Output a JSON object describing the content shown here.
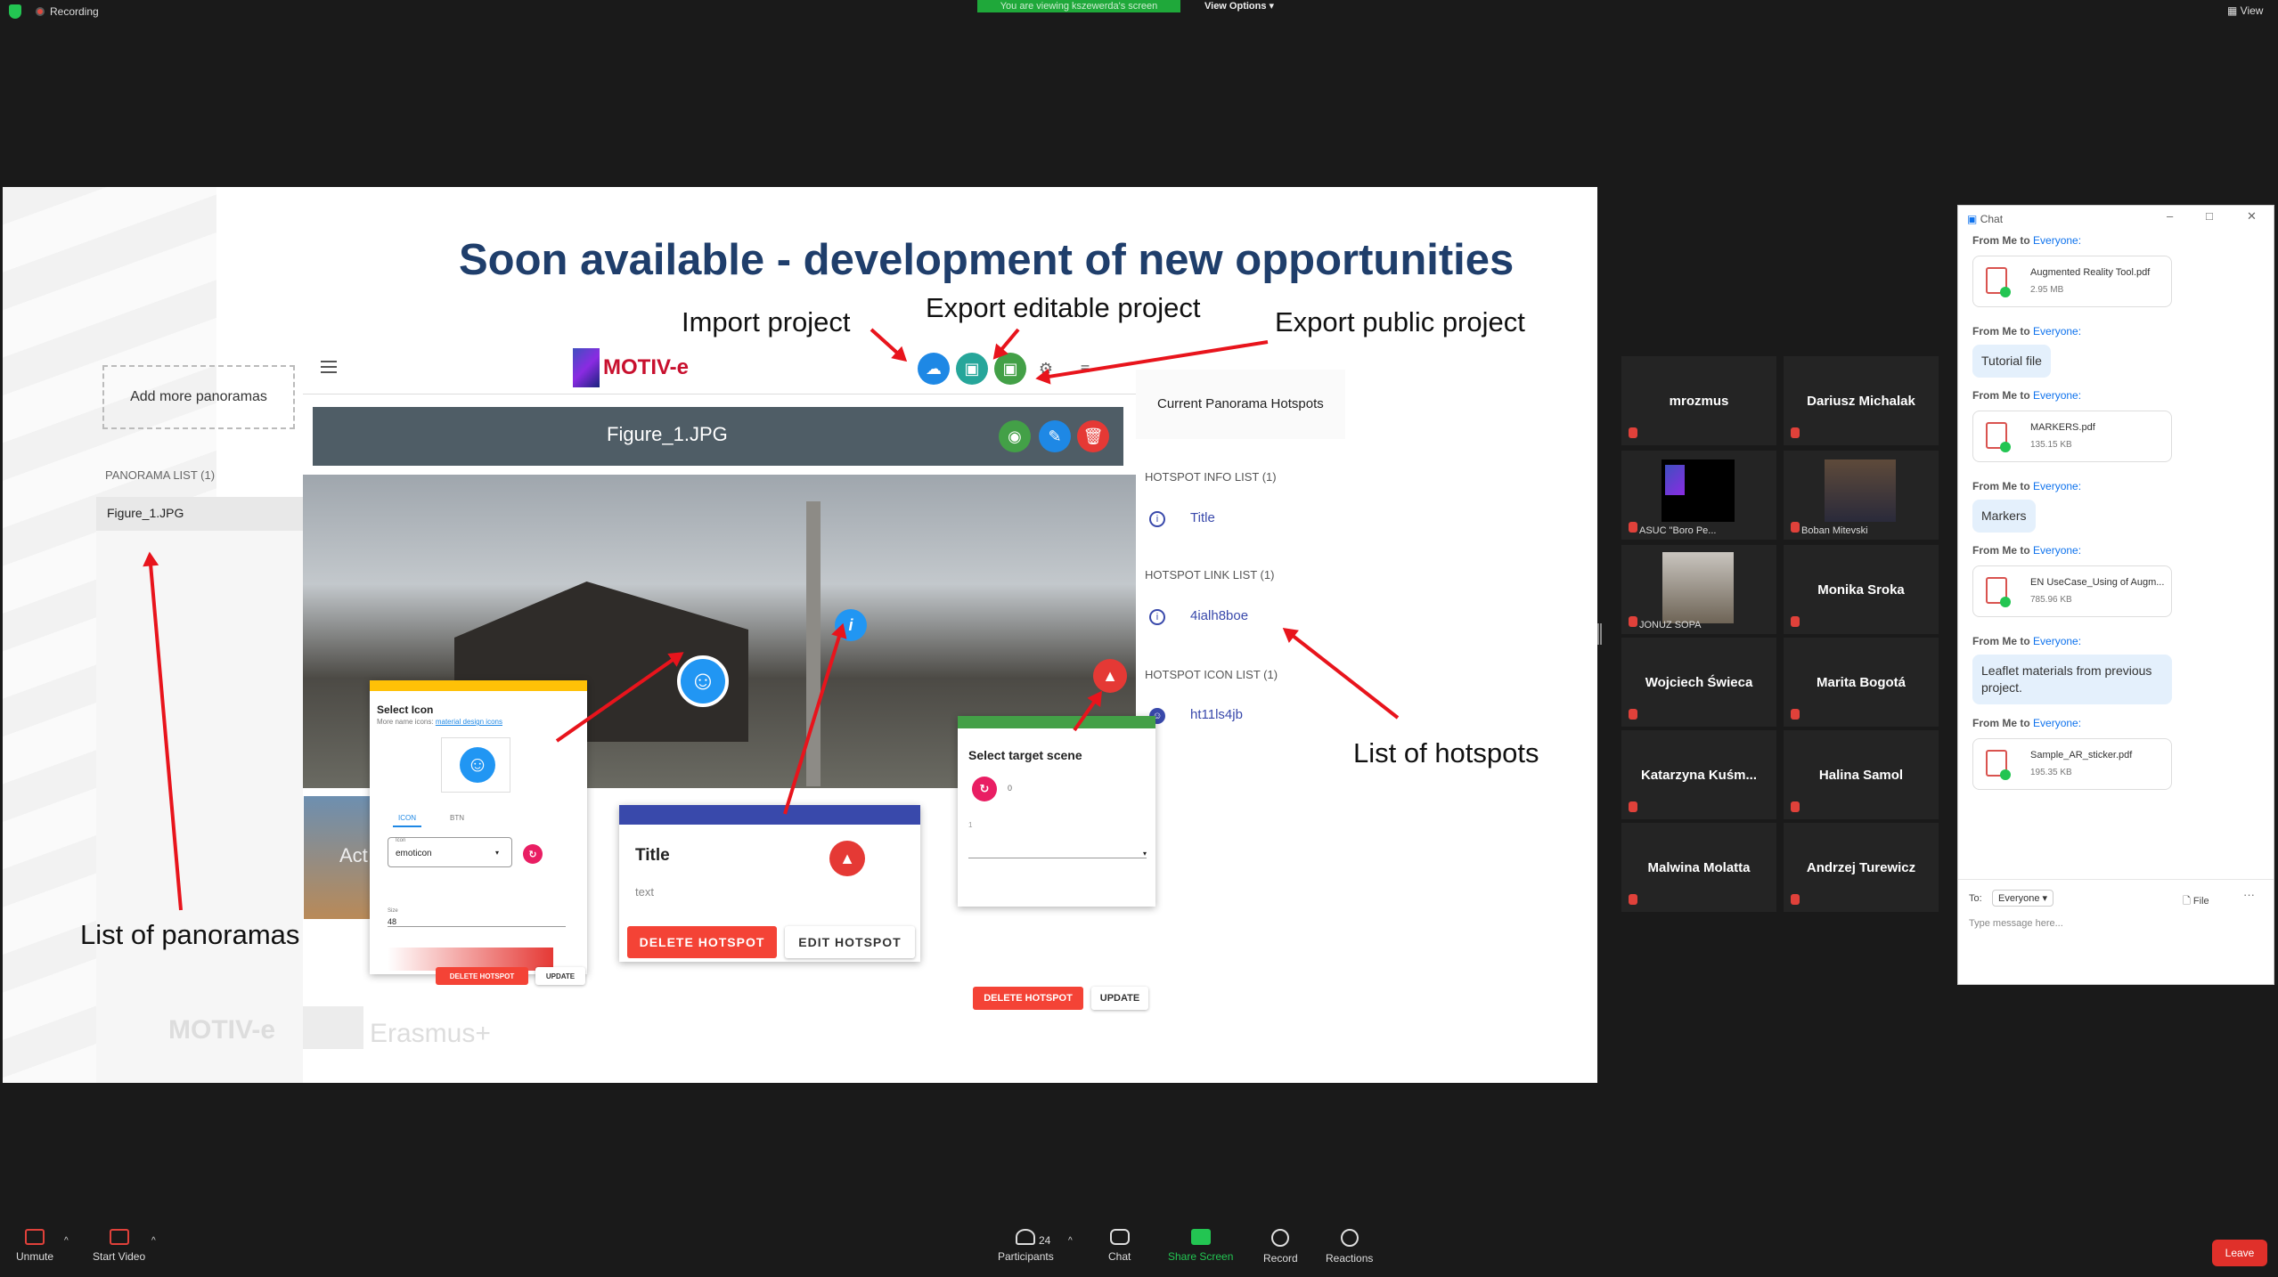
{
  "topbar": {
    "recording": "Recording",
    "viewing_banner": "You are viewing kszewerda's screen",
    "view_options": "View Options",
    "view": "View"
  },
  "slide": {
    "title": "Soon available - development of new opportunities",
    "callouts": {
      "import": "Import project",
      "export_editable": "Export editable project",
      "export_public": "Export public project",
      "list_hotspots": "List of hotspots",
      "list_panoramas": "List of panoramas"
    },
    "app": {
      "add_more": "Add more panoramas",
      "panorama_list_title": "PANORAMA LIST (1)",
      "panorama_item": "Figure_1.JPG",
      "logo_text": "MOTIV-e",
      "figure_name": "Figure_1.JPG",
      "current_hotspots": "Current Panorama Hotspots",
      "info_list_title": "HOTSPOT INFO LIST (1)",
      "info_item": "Title",
      "link_list_title": "HOTSPOT LINK LIST (1)",
      "link_item": "4ialh8boe",
      "icon_list_title": "HOTSPOT ICON LIST (1)",
      "icon_item": "ht11ls4jb"
    },
    "select_icon_dialog": {
      "title": "Select Icon",
      "more": "More name icons:",
      "link": "material design icons",
      "tab_icon": "ICON",
      "tab_btn": "BTN",
      "field_label": "Icon",
      "field_value": "emoticon",
      "size_label": "Size",
      "size_value": "48",
      "delete": "DELETE HOTSPOT",
      "update": "UPDATE"
    },
    "info_card": {
      "title": "Title",
      "text": "text",
      "delete": "DELETE HOTSPOT",
      "edit": "EDIT HOTSPOT"
    },
    "target_dialog": {
      "title": "Select target scene",
      "value_0": "0",
      "value_1": "1",
      "delete": "DELETE HOTSPOT",
      "update": "UPDATE"
    },
    "watermarks": {
      "motive": "MOTIV-e",
      "erasmus": "Erasmus+"
    },
    "logo_caption": "ASUC \"Boro Pe...",
    "preview_text": "Act"
  },
  "participants": [
    {
      "name": "mrozmus"
    },
    {
      "name": "Dariusz Michalak"
    },
    {
      "name": "ASUC \"Boro Pe..."
    },
    {
      "name": "Boban Mitevski"
    },
    {
      "name": "JONUZ SOPA"
    },
    {
      "name": "Monika Sroka"
    },
    {
      "name": "Wojciech Świeca"
    },
    {
      "name": "Marita Bogotá"
    },
    {
      "name": "Katarzyna  Kuśm..."
    },
    {
      "name": "Halina Samol"
    },
    {
      "name": "Malwina Molatta"
    },
    {
      "name": "Andrzej Turewicz"
    }
  ],
  "chat": {
    "window_title": "Chat",
    "messages": [
      {
        "from": "From Me to",
        "to": "Everyone:",
        "file": "Augmented Reality Tool.pdf",
        "size": "2.95 MB"
      },
      {
        "from": "From Me to",
        "to": "Everyone:",
        "text": "Tutorial file"
      },
      {
        "from": "From Me to",
        "to": "Everyone:",
        "file": "MARKERS.pdf",
        "size": "135.15 KB"
      },
      {
        "from": "From Me to",
        "to": "Everyone:",
        "text": "Markers"
      },
      {
        "from": "From Me to",
        "to": "Everyone:",
        "file": "EN UseCase_Using of Augm...",
        "size": "785.96 KB"
      },
      {
        "from": "From Me to",
        "to": "Everyone:",
        "text": "Leaflet materials from previous project."
      },
      {
        "from": "From Me to",
        "to": "Everyone:",
        "file": "Sample_AR_sticker.pdf",
        "size": "195.35 KB"
      }
    ],
    "to_label": "To:",
    "to_value": "Everyone",
    "file_label": "File",
    "placeholder": "Type message here..."
  },
  "bottombar": {
    "unmute": "Unmute",
    "start_video": "Start Video",
    "participants": "Participants",
    "participants_count": "24",
    "chat": "Chat",
    "share": "Share Screen",
    "record": "Record",
    "reactions": "Reactions",
    "leave": "Leave"
  }
}
